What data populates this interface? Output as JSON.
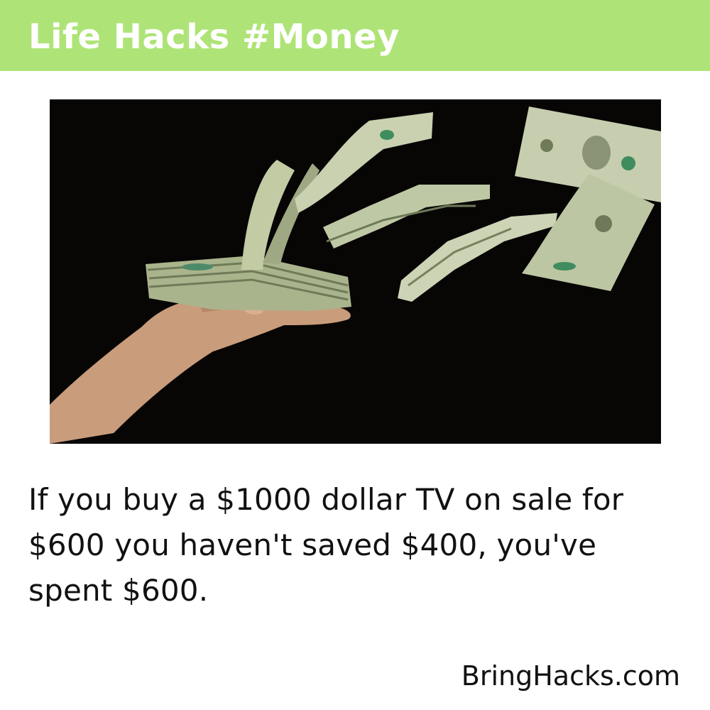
{
  "header": {
    "title": "Life Hacks #Money",
    "background_color": "#aee477"
  },
  "photo": {
    "icon": "money-flying-from-hand-image",
    "background_color": "#070605",
    "bill_color": "#b9c39b"
  },
  "tip": {
    "text": "If you buy a $1000 dollar TV on sale for $600 you haven't saved $400, you've spent $600."
  },
  "footer": {
    "source": "BringHacks.com"
  }
}
